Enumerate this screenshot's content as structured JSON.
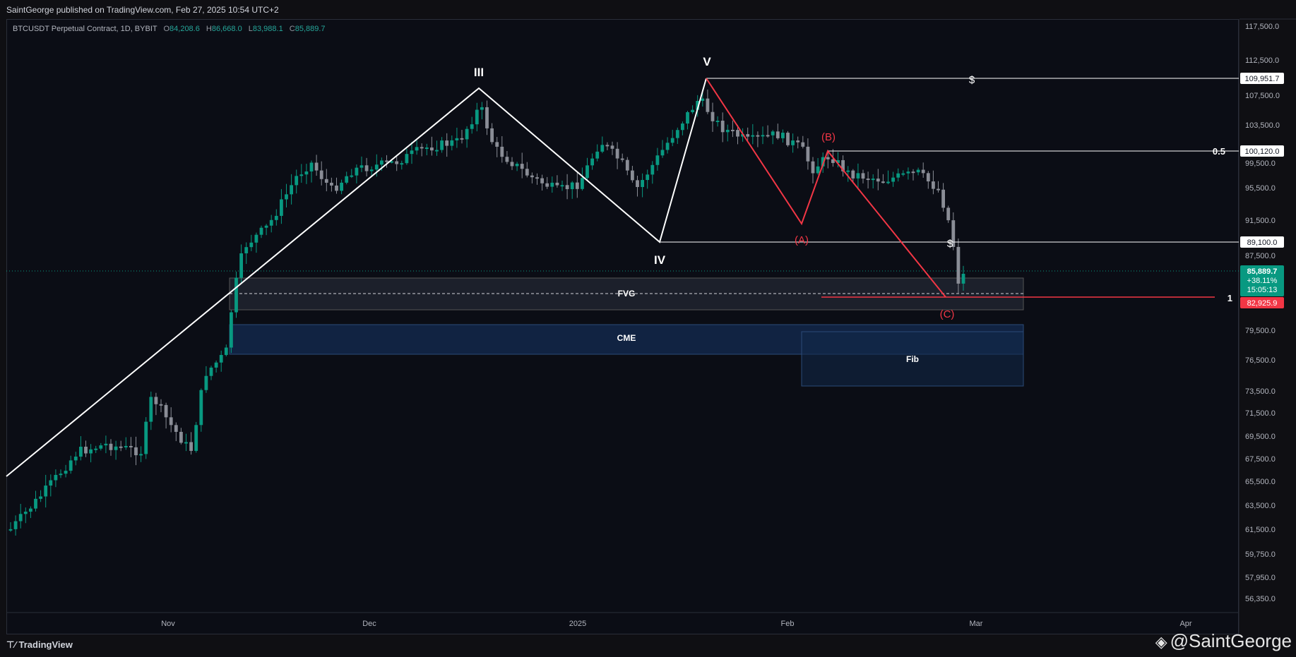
{
  "header": {
    "publisher_line": "SaintGeorge published on TradingView.com, Feb 27, 2025 10:54 UTC+2"
  },
  "legend": {
    "symbol": "BTCUSDT Perpetual Contract, 1D, BYBIT",
    "open_label": "O",
    "open": "84,208.6",
    "high_label": "H",
    "high": "86,668.0",
    "low_label": "L",
    "low": "83,988.1",
    "close_label": "C",
    "close": "85,889.7"
  },
  "chart_data": {
    "type": "candlestick",
    "y_ticks": [
      "117,500.0",
      "112,500.0",
      "107,500.0",
      "103,500.0",
      "99,500.0",
      "95,500.0",
      "91,500.0",
      "87,500.0",
      "79,500.0",
      "76,500.0",
      "73,500.0",
      "71,500.0",
      "69,500.0",
      "67,500.0",
      "65,500.0",
      "63,500.0",
      "61,500.0",
      "59,750.0",
      "57,950.0",
      "56,350.0"
    ],
    "x_ticks": [
      "Nov",
      "Dec",
      "2025",
      "Feb",
      "Mar",
      "Apr"
    ],
    "price_labels": [
      {
        "text": "109,951.7",
        "color": "#ffffff"
      },
      {
        "text": "100,120.0",
        "color": "#ffffff"
      },
      {
        "text": "89,100.0",
        "color": "#ffffff"
      },
      {
        "text": "85,889.7",
        "sub": "+38.11%",
        "time": "15:05:13",
        "color": "#089981"
      },
      {
        "text": "82,925.9",
        "color": "#f23645"
      }
    ],
    "wave_labels": [
      "III",
      "IV",
      "V"
    ],
    "correction_labels": [
      "(A)",
      "(B)",
      "(C)"
    ],
    "zones": [
      "FVG",
      "CME",
      "Fib"
    ],
    "level_labels": [
      "0.5",
      "1"
    ],
    "markers": [
      "$",
      "$"
    ],
    "colors": {
      "up": "#089981",
      "down": "#8a8d96",
      "wave": "#ffffff",
      "correction": "#f23645",
      "zone_blue": "#1e3a5f"
    }
  },
  "footer": {
    "brand": "TradingView",
    "watermark": "@SaintGeorge"
  }
}
